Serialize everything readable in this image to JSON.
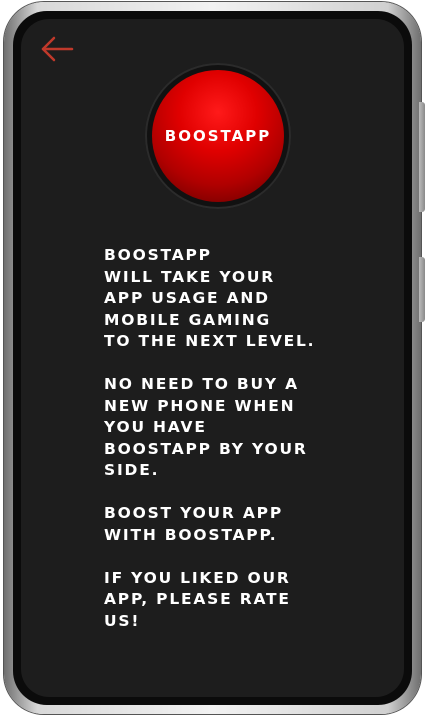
{
  "app": {
    "back_icon": "arrow-left-icon",
    "boost_button_label": "BOOSTAPP",
    "accent_color": "#e00000",
    "screen_background": "#1d1d1d"
  },
  "description": {
    "paragraphs": [
      "BOOSTAPP\nWILL TAKE YOUR\nAPP USAGE AND\nMOBILE GAMING\nTO THE NEXT LEVEL.",
      "NO NEED TO BUY A\nNEW PHONE WHEN\nYOU HAVE\nBOOSTAPP BY YOUR\nSIDE.",
      "BOOST YOUR APP\nWITH BOOSTAPP.",
      "IF YOU LIKED OUR\nAPP, PLEASE RATE\nUS!"
    ]
  }
}
